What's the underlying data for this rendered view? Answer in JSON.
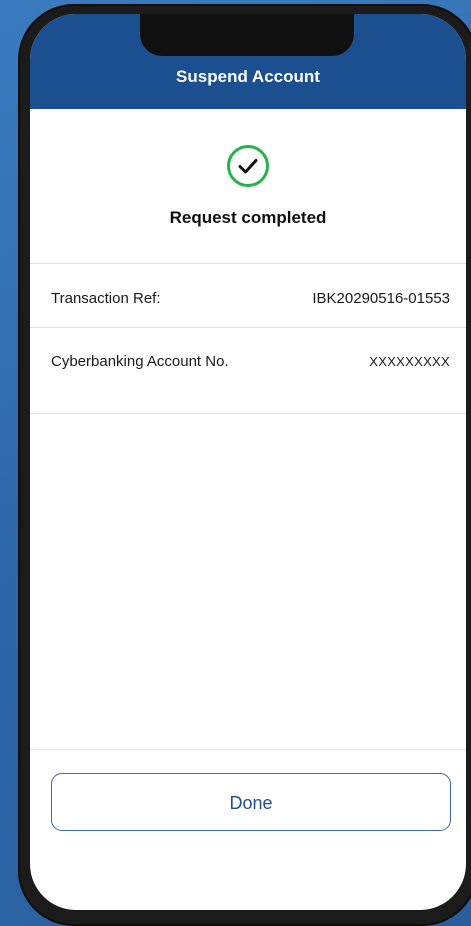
{
  "header": {
    "title": "Suspend Account"
  },
  "status": {
    "icon": "check-circle-icon",
    "text": "Request completed",
    "color": "#27b34a"
  },
  "details": [
    {
      "label": "Transaction Ref:",
      "value": "IBK20290516-01553"
    },
    {
      "label": "Cyberbanking Account No.",
      "value": "XXXXXXXXX"
    }
  ],
  "actions": {
    "done_label": "Done"
  },
  "colors": {
    "nav_bar": "#1c4f90",
    "background": "#2f6fb0",
    "button_border": "#3b6aa0"
  }
}
